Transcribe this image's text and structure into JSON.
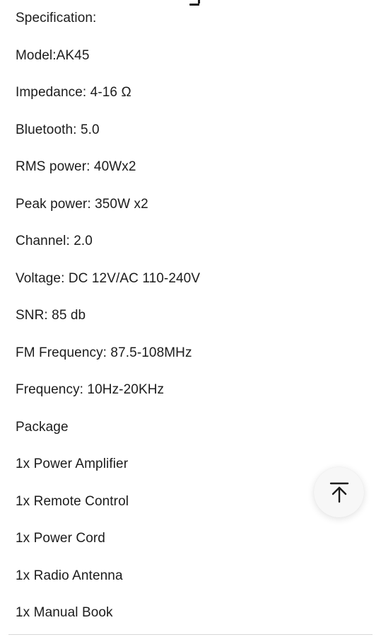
{
  "spec_lines": [
    "Specification:",
    "Model:AK45",
    "Impedance: 4-16 Ω",
    "Bluetooth: 5.0",
    "RMS power: 40Wx2",
    "Peak power: 350W x2",
    "Channel: 2.0",
    "Voltage: DC 12V/AC 110-240V",
    "SNR: 85 db",
    "FM Frequency: 87.5-108MHz",
    "Frequency: 10Hz-20KHz",
    "Package",
    "1x Power Amplifier",
    "1x Remote Control",
    "1x Power Cord",
    "1x Radio Antenna",
    "1x Manual Book"
  ],
  "back_to_top": {
    "icon": "arrow-up-to-line-icon"
  }
}
